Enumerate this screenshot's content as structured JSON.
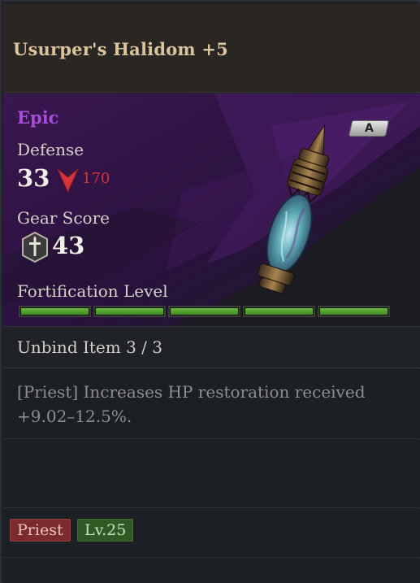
{
  "item": {
    "name": "Usurper's Halidom +5",
    "rarity": "Epic",
    "grade": "A",
    "defense_label": "Defense",
    "defense_value": "33",
    "defense_delta": "170",
    "gear_score_label": "Gear Score",
    "gear_score_value": "43",
    "fortification_label": "Fortification Level",
    "fortification": {
      "filled": 5,
      "total": 5
    },
    "unbind_text": "Unbind Item 3 / 3",
    "description": "[Priest] Increases HP restoration received +9.02–12.5%.",
    "class_tag": "Priest",
    "level_tag": "Lv.25"
  },
  "icons": {
    "down_arrow": "red-down-arrow-icon",
    "gear_score": "gear-score-sword-icon",
    "item": "halidom-relic-icon"
  },
  "colors": {
    "title": "#dcc49a",
    "rarity_epic": "#a54fd8",
    "decrease": "#d8323a",
    "fortify_bar": "#5aa632",
    "class_tag_bg": "#7c2b2b",
    "level_tag_bg": "#2f5a24"
  }
}
